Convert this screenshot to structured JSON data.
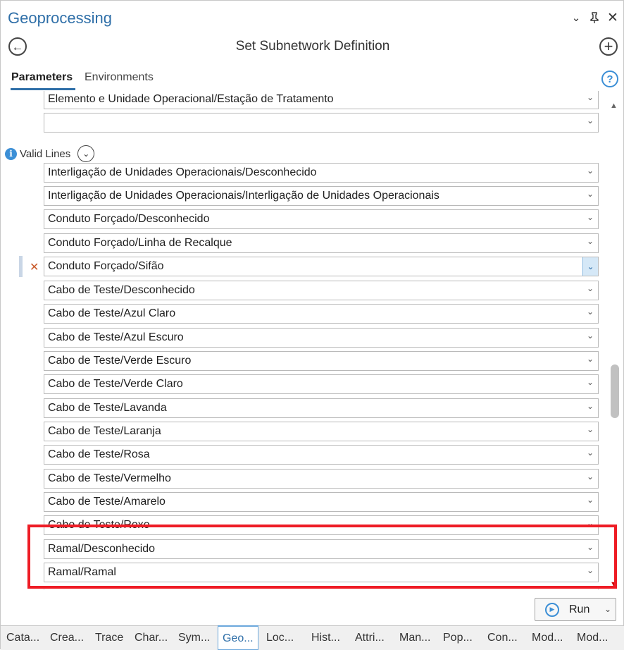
{
  "pane": {
    "title": "Geoprocessing",
    "controls": [
      "chevron-down",
      "pin",
      "close"
    ]
  },
  "tool": {
    "title": "Set Subnetwork Definition"
  },
  "tabs": [
    {
      "label": "Parameters",
      "active": true
    },
    {
      "label": "Environments",
      "active": false
    }
  ],
  "help_label": "?",
  "rows_above": [
    "Elemento e Unidade Operacional/Estação de Tratamento",
    ""
  ],
  "valid_lines": {
    "label": "Valid Lines",
    "items": [
      "Interligação de Unidades Operacionais/Desconhecido",
      "Interligação de Unidades Operacionais/Interligação de Unidades Operacionais",
      "Conduto Forçado/Desconhecido",
      "Conduto Forçado/Linha de Recalque",
      "Conduto Forçado/Sifão",
      "Cabo de Teste/Desconhecido",
      "Cabo de Teste/Azul Claro",
      "Cabo de Teste/Azul Escuro",
      "Cabo de Teste/Verde Escuro",
      "Cabo de Teste/Verde Claro",
      "Cabo de Teste/Lavanda",
      "Cabo de Teste/Laranja",
      "Cabo de Teste/Rosa",
      "Cabo de Teste/Vermelho",
      "Cabo de Teste/Amarelo",
      "Cabo de Teste/Roxo",
      "Ramal/Desconhecido",
      "Ramal/Ramal"
    ],
    "selected_item": "Conduto Forçado/Sifão"
  },
  "run_button": {
    "label": "Run"
  },
  "bottom_tabs": [
    {
      "label": "Cata...",
      "active": false
    },
    {
      "label": "Crea...",
      "active": false
    },
    {
      "label": "Trace",
      "active": false
    },
    {
      "label": "Char...",
      "active": false
    },
    {
      "label": "Sym...",
      "active": false
    },
    {
      "label": "Geo...",
      "active": true
    },
    {
      "label": "Loc...",
      "active": false
    },
    {
      "label": "Hist...",
      "active": false
    },
    {
      "label": "Attri...",
      "active": false
    },
    {
      "label": "Man...",
      "active": false
    },
    {
      "label": "Pop...",
      "active": false
    },
    {
      "label": "Con...",
      "active": false
    },
    {
      "label": "Mod...",
      "active": false
    },
    {
      "label": "Mod...",
      "active": false
    }
  ],
  "colors": {
    "accent": "#2f6fa8",
    "highlight_box": "#ee1c25",
    "remove_icon": "#c95a2a"
  }
}
